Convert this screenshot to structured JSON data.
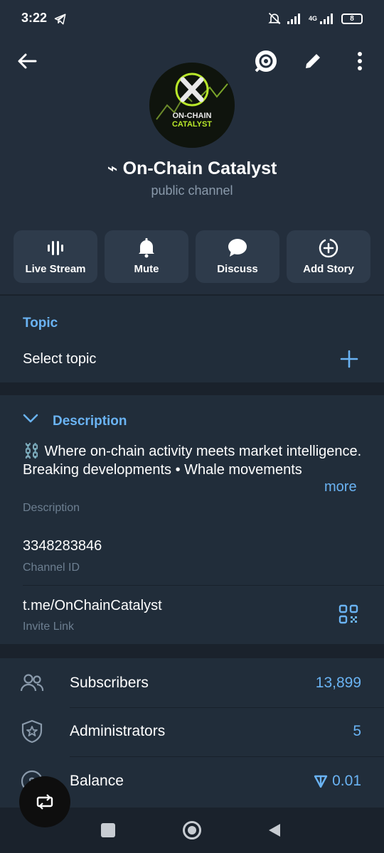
{
  "status_bar": {
    "time": "3:22",
    "network": "4G",
    "battery": "8"
  },
  "channel": {
    "name": "⌁ On-Chain Catalyst",
    "type": "public channel",
    "avatar_text_line1": "ON-CHAIN",
    "avatar_text_line2": "CATALYST"
  },
  "actions": [
    {
      "label": "Live Stream",
      "icon": "live-stream-icon"
    },
    {
      "label": "Mute",
      "icon": "bell-icon"
    },
    {
      "label": "Discuss",
      "icon": "chat-bubble-icon"
    },
    {
      "label": "Add Story",
      "icon": "add-story-icon"
    }
  ],
  "topic": {
    "title": "Topic",
    "value": "Select topic"
  },
  "description": {
    "title": "Description",
    "line1": "⛓️ Where on-chain activity meets market intelligence.",
    "line2": "Breaking developments • Whale movements",
    "more": "more",
    "label": "Description"
  },
  "channel_id": {
    "value": "3348283846",
    "label": "Channel ID"
  },
  "invite_link": {
    "value": "t.me/OnChainCatalyst",
    "label": "Invite Link"
  },
  "stats": [
    {
      "label": "Subscribers",
      "value": "13,899",
      "icon": "users-icon"
    },
    {
      "label": "Administrators",
      "value": "5",
      "icon": "shield-star-icon"
    },
    {
      "label": "Balance",
      "value": "0.01",
      "icon": "dollar-circle-icon"
    }
  ],
  "colors": {
    "accent": "#6ab3f3",
    "header_bg": "#232e3c",
    "card_bg": "#212d3a",
    "page_bg": "#1a222c"
  }
}
